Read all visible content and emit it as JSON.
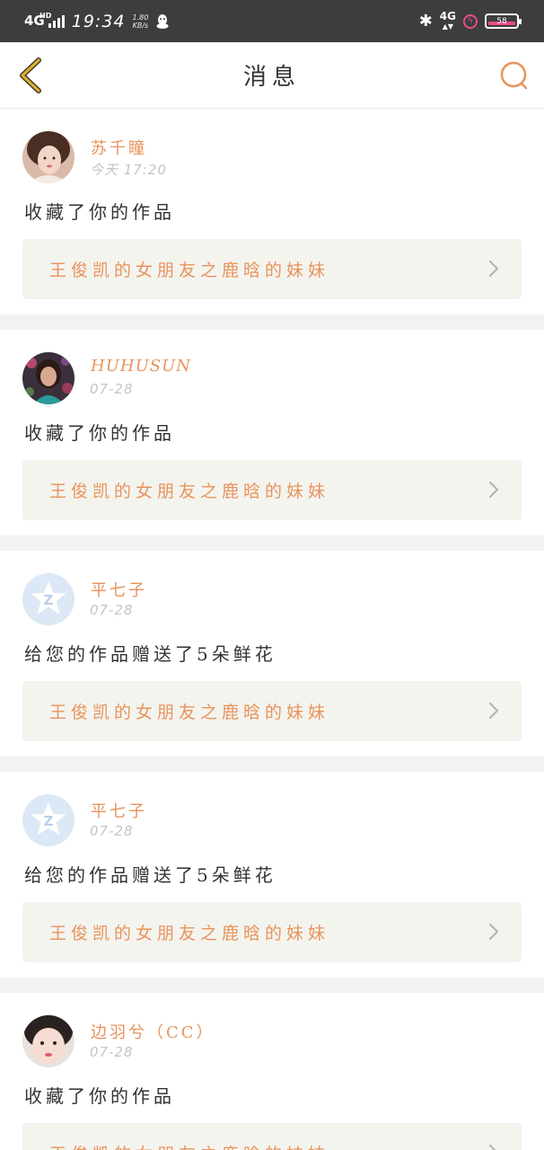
{
  "status_bar": {
    "network": "4G",
    "network_sup": "HD",
    "time": "19:34",
    "speed_value": "1.80",
    "speed_unit": "KB/s",
    "bluetooth_icon": "bluetooth-icon",
    "cell_label": "4G",
    "battery_level": "58"
  },
  "nav": {
    "title": "消息",
    "back_icon": "chevron-left-icon",
    "search_icon": "search-icon"
  },
  "colors": {
    "accent": "#e8935c",
    "back_arrow": "#e0b030",
    "card_link_bg": "#f4f4ef",
    "status_bar_bg": "#3d3d3d"
  },
  "messages": [
    {
      "user": "苏千瞳",
      "time": "今天 17:20",
      "action": "收藏了你的作品",
      "work": "王俊凯的女朋友之鹿晗的妹妹",
      "avatar": "photo-avatar-1"
    },
    {
      "user": "HUHUSUN",
      "time": "07-28",
      "action": "收藏了你的作品",
      "work": "王俊凯的女朋友之鹿晗的妹妹",
      "avatar": "photo-avatar-2"
    },
    {
      "user": "平七子",
      "time": "07-28",
      "action": "给您的作品赠送了5朵鲜花",
      "work": "王俊凯的女朋友之鹿晗的妹妹",
      "avatar": "default-avatar"
    },
    {
      "user": "平七子",
      "time": "07-28",
      "action": "给您的作品赠送了5朵鲜花",
      "work": "王俊凯的女朋友之鹿晗的妹妹",
      "avatar": "default-avatar"
    },
    {
      "user": "边羽兮（CC）",
      "time": "07-28",
      "action": "收藏了你的作品",
      "work": "王俊凯的女朋友之鹿晗的妹妹",
      "avatar": "photo-avatar-3"
    }
  ]
}
